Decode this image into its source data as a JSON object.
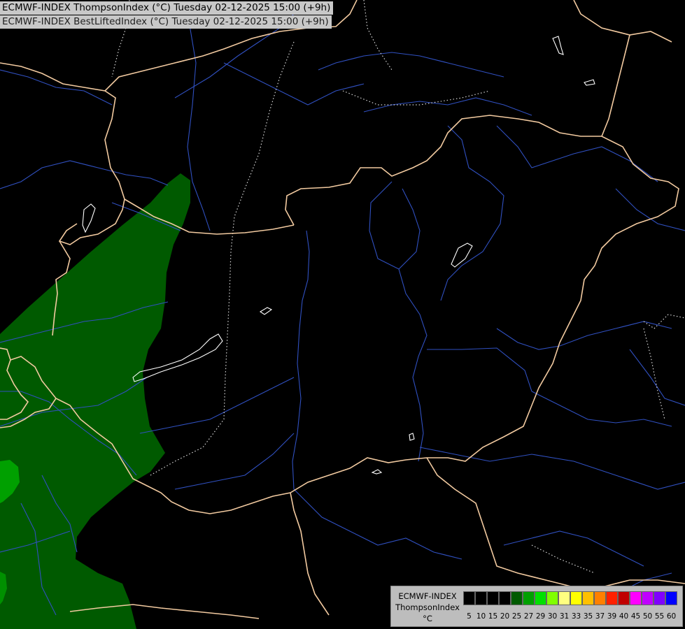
{
  "title": {
    "line1": "ECMWF-INDEX ThompsonIndex (°C) Tuesday 02-12-2025 15:00 (+9h)",
    "line2": "ECMWF-INDEX BestLiftedIndex (°C) Tuesday 02-12-2025 15:00 (+9h)"
  },
  "legend": {
    "line1": "ECMWF-INDEX",
    "line2": "ThompsonIndex",
    "unit": "°C",
    "ticks": [
      "5",
      "10",
      "15",
      "20",
      "25",
      "27",
      "29",
      "30",
      "31",
      "33",
      "35",
      "37",
      "39",
      "40",
      "45",
      "50",
      "55",
      "60"
    ],
    "colors": [
      "#000000",
      "#000000",
      "#000000",
      "#000000",
      "#005a00",
      "#00a000",
      "#00e000",
      "#80ff00",
      "#ffff80",
      "#ffff00",
      "#ffc000",
      "#ff8000",
      "#ff2000",
      "#c00000",
      "#ff00ff",
      "#c000ff",
      "#8000ff",
      "#0000ff"
    ]
  },
  "map_colors": {
    "background": "#000000",
    "field_dark_green": "#005a00",
    "field_green": "#00a000",
    "field_bright_green": "#00c000",
    "border": "#f2caa0",
    "river": "#3050c0",
    "lake_outline": "#ffffff",
    "dotted_border": "#d8d8d8"
  }
}
